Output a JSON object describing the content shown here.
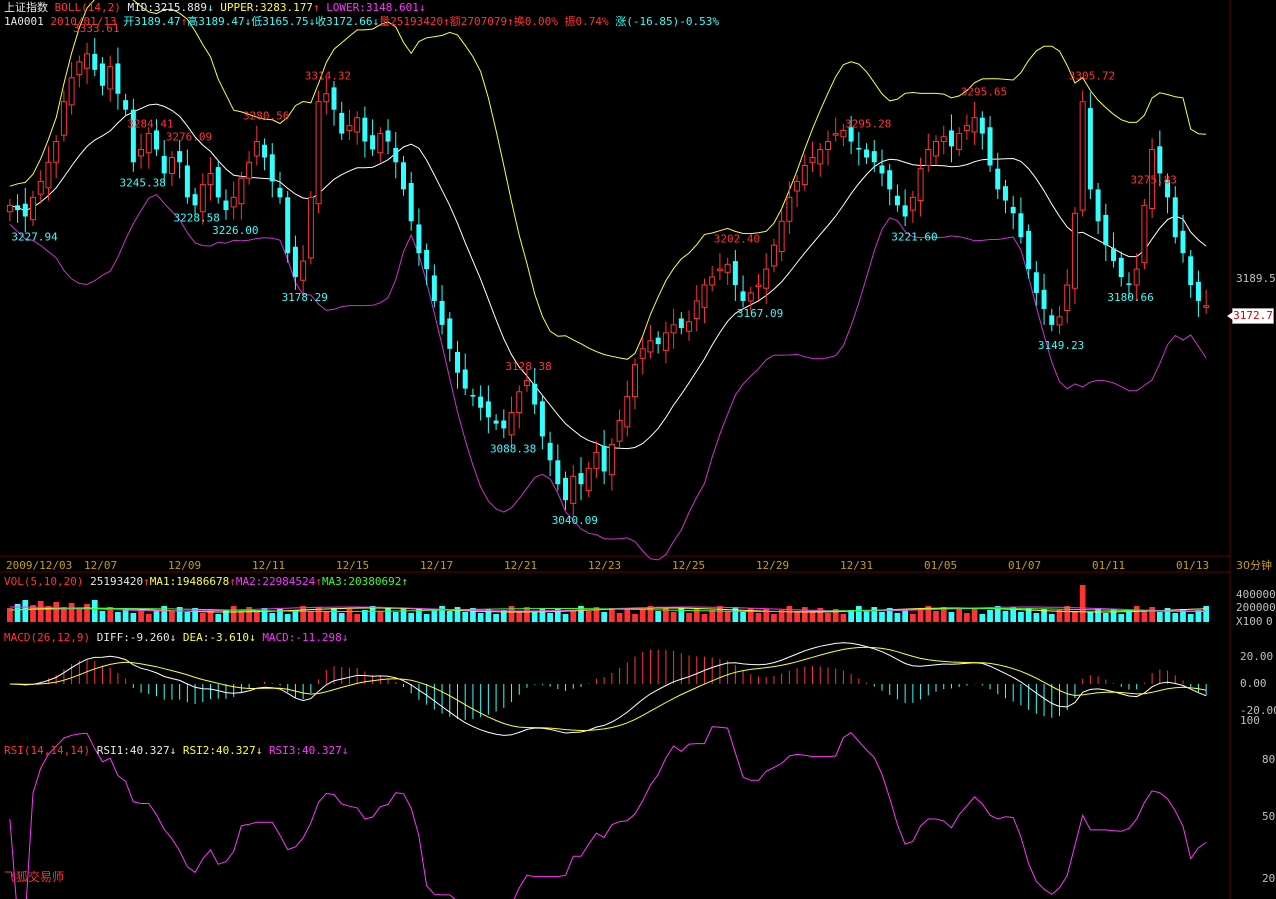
{
  "header": {
    "index_name": "上证指数",
    "boll_label": "BOLL(14,2)",
    "mid": "MID:3215.889",
    "upper": "UPPER:3283.177",
    "lower": "LOWER:3148.601",
    "code": "1A0001",
    "date": "2010/01/13",
    "open": "开3189.47",
    "high": "高3189.47",
    "low": "低3165.75",
    "close": "收3172.66",
    "volume": "量25193420",
    "amount": "额2707079",
    "turnover": "换0.00%",
    "amplitude": "振0.74%",
    "change": "涨(-16.85)-0.53%"
  },
  "vol_header": {
    "label": "VOL(5,10,20)",
    "vol": "25193420",
    "ma1": "MA1:19486678",
    "ma2": "MA2:22984524",
    "ma3": "MA3:20380692"
  },
  "macd_header": {
    "label": "MACD(26,12,9)",
    "diff": "DIFF:-9.260",
    "dea": "DEA:-3.610",
    "macd": "MACD:-11.298"
  },
  "rsi_header": {
    "label": "RSI(14,14,14)",
    "rsi1": "RSI1:40.327",
    "rsi2": "RSI2:40.327",
    "rsi3": "RSI3:40.327"
  },
  "brand": "飞狐交易师",
  "current_price_label": "3172.7",
  "chart_data": {
    "type": "candlestick",
    "price_axis": {
      "ylim": [
        3020,
        3345
      ],
      "ticks": [
        "3189.5"
      ]
    },
    "x_labels": [
      "2009/12/03",
      "12/07",
      "12/09",
      "12/11",
      "12/15",
      "12/17",
      "12/21",
      "12/23",
      "12/25",
      "12/29",
      "12/31",
      "01/05",
      "01/07",
      "01/11",
      "01/13"
    ],
    "interval_label": "30分钟",
    "annotations": [
      {
        "text": "3333.61",
        "color": "#ff3333",
        "i": 10
      },
      {
        "text": "3227.94",
        "color": "#33ffff",
        "i": 2
      },
      {
        "text": "3284.41",
        "color": "#ff3333",
        "i": 17
      },
      {
        "text": "3245.38",
        "color": "#33ffff",
        "i": 16
      },
      {
        "text": "3276.09",
        "color": "#ff3333",
        "i": 22
      },
      {
        "text": "3228.58",
        "color": "#33ffff",
        "i": 23
      },
      {
        "text": "3226.00",
        "color": "#33ffff",
        "i": 28
      },
      {
        "text": "3280.56",
        "color": "#ff3333",
        "i": 32
      },
      {
        "text": "3178.29",
        "color": "#33ffff",
        "i": 37
      },
      {
        "text": "3314.32",
        "color": "#ff3333",
        "i": 40
      },
      {
        "text": "3128.38",
        "color": "#ff3333",
        "i": 66
      },
      {
        "text": "3088.38",
        "color": "#33ffff",
        "i": 64
      },
      {
        "text": "3040.09",
        "color": "#33ffff",
        "i": 72
      },
      {
        "text": "3202.40",
        "color": "#ff3333",
        "i": 93
      },
      {
        "text": "3167.09",
        "color": "#33ffff",
        "i": 96
      },
      {
        "text": "3295.28",
        "color": "#ff3333",
        "i": 110
      },
      {
        "text": "3221.60",
        "color": "#33ffff",
        "i": 116
      },
      {
        "text": "3295.65",
        "color": "#ff3333",
        "i": 125
      },
      {
        "text": "3305.72",
        "color": "#ff3333",
        "i": 139
      },
      {
        "text": "3149.23",
        "color": "#33ffff",
        "i": 135
      },
      {
        "text": "3180.66",
        "color": "#33ffff",
        "i": 144
      },
      {
        "text": "3275.83",
        "color": "#ff3333",
        "i": 147
      }
    ],
    "close_path": [
      3235,
      3232,
      3228,
      3240,
      3250,
      3262,
      3275,
      3300,
      3315,
      3325,
      3330,
      3320,
      3310,
      3322,
      3305,
      3295,
      3262,
      3270,
      3280,
      3270,
      3255,
      3265,
      3262,
      3240,
      3235,
      3248,
      3255,
      3240,
      3232,
      3240,
      3252,
      3262,
      3275,
      3265,
      3250,
      3240,
      3205,
      3190,
      3200,
      3240,
      3300,
      3305,
      3295,
      3280,
      3285,
      3290,
      3275,
      3270,
      3280,
      3275,
      3262,
      3245,
      3225,
      3205,
      3195,
      3175,
      3160,
      3145,
      3130,
      3120,
      3115,
      3108,
      3102,
      3098,
      3095,
      3105,
      3118,
      3125,
      3110,
      3090,
      3075,
      3060,
      3050,
      3065,
      3060,
      3070,
      3080,
      3068,
      3085,
      3100,
      3115,
      3135,
      3145,
      3150,
      3148,
      3155,
      3160,
      3158,
      3162,
      3175,
      3185,
      3190,
      3195,
      3198,
      3185,
      3175,
      3180,
      3185,
      3195,
      3210,
      3225,
      3240,
      3250,
      3260,
      3265,
      3270,
      3275,
      3280,
      3282,
      3275,
      3270,
      3265,
      3262,
      3255,
      3245,
      3235,
      3228,
      3240,
      3258,
      3270,
      3275,
      3278,
      3272,
      3280,
      3285,
      3290,
      3280,
      3260,
      3245,
      3238,
      3230,
      3215,
      3195,
      3180,
      3170,
      3160,
      3165,
      3185,
      3230,
      3300,
      3245,
      3225,
      3210,
      3200,
      3190,
      3185,
      3195,
      3235,
      3270,
      3255,
      3240,
      3215,
      3205,
      3185,
      3175,
      3172
    ],
    "volume_axis": {
      "ticks": [
        "400000",
        "200000",
        "X100",
        "0"
      ]
    },
    "macd_axis": {
      "ticks": [
        "20.00",
        "0.00",
        "-20.00",
        "100"
      ]
    },
    "rsi_axis": {
      "ticks": [
        "80",
        "50",
        "20"
      ],
      "ylim": [
        20,
        80
      ]
    }
  }
}
